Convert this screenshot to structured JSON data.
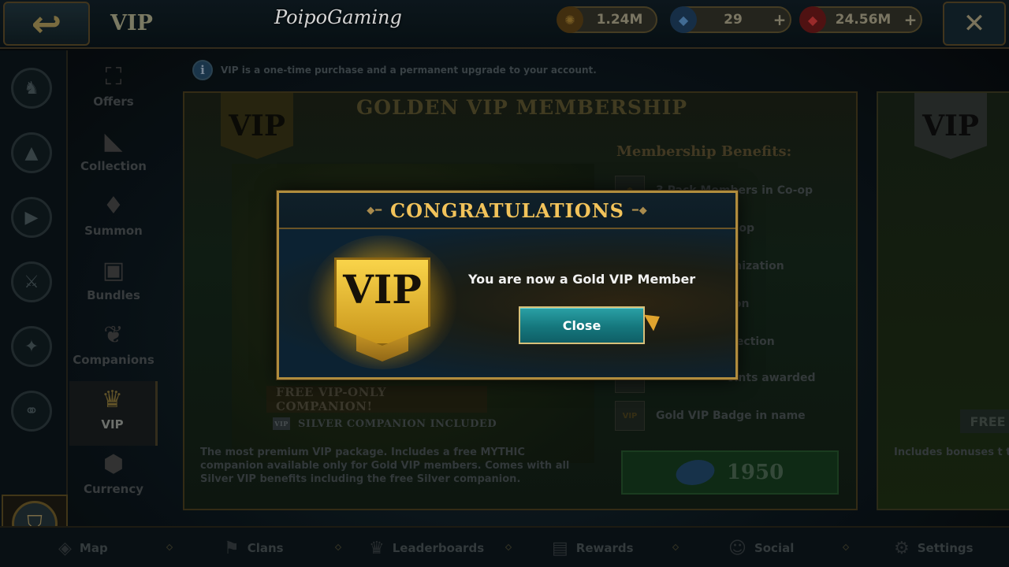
{
  "header": {
    "title": "VIP",
    "watermark": "PoipoGaming",
    "resources": [
      {
        "icon": "gold-coin-icon",
        "value": "1.24M",
        "has_plus": false
      },
      {
        "icon": "crystal-gem-icon",
        "value": "29",
        "has_plus": true
      },
      {
        "icon": "ruby-gem-icon",
        "value": "24.56M",
        "has_plus": true
      }
    ]
  },
  "info_text": "VIP is a one-time purchase and a permanent upgrade to your account.",
  "categories": [
    {
      "label": "Offers",
      "icon": "offers-tag-icon"
    },
    {
      "label": "Collection",
      "icon": "wolf-icon"
    },
    {
      "label": "Summon",
      "icon": "crystal-icon"
    },
    {
      "label": "Bundles",
      "icon": "shopping-bag-icon"
    },
    {
      "label": "Companions",
      "icon": "bird-icon"
    },
    {
      "label": "VIP",
      "icon": "crown-icon",
      "active": true
    },
    {
      "label": "Currency",
      "icon": "gem-icon"
    }
  ],
  "card": {
    "title": "GOLDEN VIP MEMBERSHIP",
    "badge": "VIP",
    "benefits_heading": "Membership Benefits:",
    "benefits": [
      {
        "icon": "pack-members-icon",
        "text": "3 Pack Members in Co-op"
      },
      {
        "icon": "coop-icon",
        "text": "in Co-op"
      },
      {
        "icon": "customization-icon",
        "text": "ustomization"
      },
      {
        "icon": "collection-icon",
        "text": "llection"
      },
      {
        "icon": "collection-icon",
        "text": "e collection"
      },
      {
        "icon": "points-icon",
        "text": "oints awarded"
      },
      {
        "icon": "vip-badge-icon",
        "text": "Gold VIP Badge in name",
        "badge_text": "VIP"
      }
    ],
    "free_companion": "FREE VIP-ONLY COMPANION!",
    "silver_included": "SILVER COMPANION INCLUDED",
    "silver_badge": "VIP",
    "description": "The most premium VIP package. Includes a free MYTHIC companion available only for Gold VIP members. Comes with all Silver VIP benefits including the free Silver companion.",
    "price": "1950"
  },
  "right_card": {
    "badge": "VIP",
    "free_label": "FREE",
    "description": "Includes bonuses t to help you get sta"
  },
  "bottom_nav": [
    {
      "label": "Map",
      "icon": "map-icon"
    },
    {
      "label": "Clans",
      "icon": "banner-icon"
    },
    {
      "label": "Leaderboards",
      "icon": "crown-icon"
    },
    {
      "label": "Rewards",
      "icon": "chest-icon"
    },
    {
      "label": "Social",
      "icon": "people-icon"
    },
    {
      "label": "Settings",
      "icon": "gear-icon"
    }
  ],
  "modal": {
    "title": "CONGRATULATIONS",
    "badge": "VIP",
    "message": "You are now a Gold VIP Member",
    "close_label": "Close"
  },
  "colors": {
    "gold_accent": "#f2c35a",
    "button_teal": "#15777d",
    "modal_bg": "#0b2030"
  }
}
